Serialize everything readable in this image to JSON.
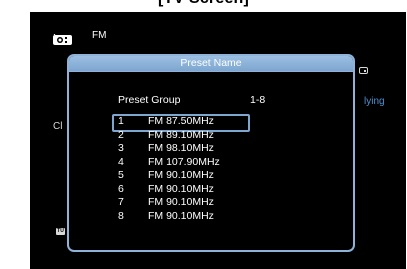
{
  "caption": "[TV Screen]",
  "header": {
    "icon": "radio-icon",
    "band": "FM"
  },
  "background": {
    "left_partial_text": "Cl",
    "right_partial_text": "lying",
    "tuner_badge": "TU",
    "remote_icon": "remote-icon"
  },
  "dialog": {
    "title": "Preset Name",
    "group_label": "Preset Group",
    "group_value": "1-8",
    "presets": [
      {
        "num": "1",
        "freq": "FM 87.50MHz",
        "selected": true
      },
      {
        "num": "2",
        "freq": "FM 89.10MHz",
        "selected": false
      },
      {
        "num": "3",
        "freq": "FM 98.10MHz",
        "selected": false
      },
      {
        "num": "4",
        "freq": "FM 107.90MHz",
        "selected": false
      },
      {
        "num": "5",
        "freq": "FM 90.10MHz",
        "selected": false
      },
      {
        "num": "6",
        "freq": "FM 90.10MHz",
        "selected": false
      },
      {
        "num": "7",
        "freq": "FM 90.10MHz",
        "selected": false
      },
      {
        "num": "8",
        "freq": "FM 90.10MHz",
        "selected": false
      }
    ]
  },
  "colors": {
    "screen_bg": "#000000",
    "accent": "#8fb3d8",
    "text": "#ffffff"
  }
}
